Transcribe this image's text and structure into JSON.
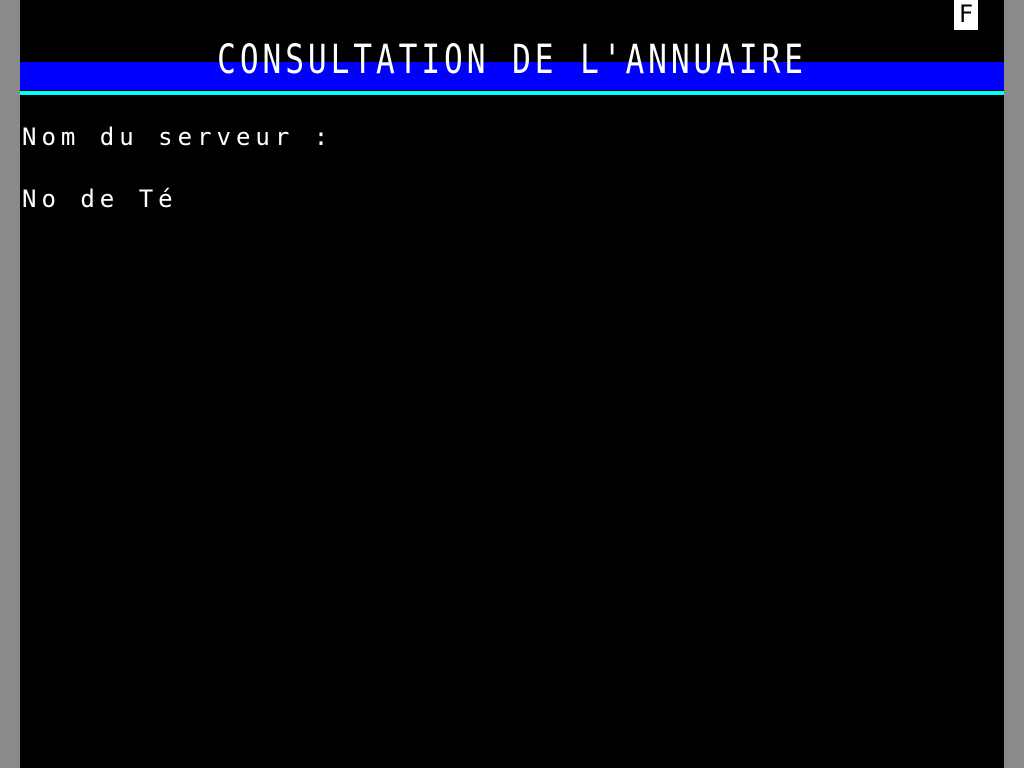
{
  "screen": {
    "title": "CONSULTATION DE L'ANNUAIRE",
    "status_indicator": "F",
    "fields": {
      "server_label": "Nom du serveur :",
      "phone_label": "No de Té"
    },
    "colors": {
      "background": "#000000",
      "header_band": "#0000ff",
      "header_rule": "#00ffff",
      "text": "#ffffff",
      "bezel": "#8a8a8a"
    }
  }
}
